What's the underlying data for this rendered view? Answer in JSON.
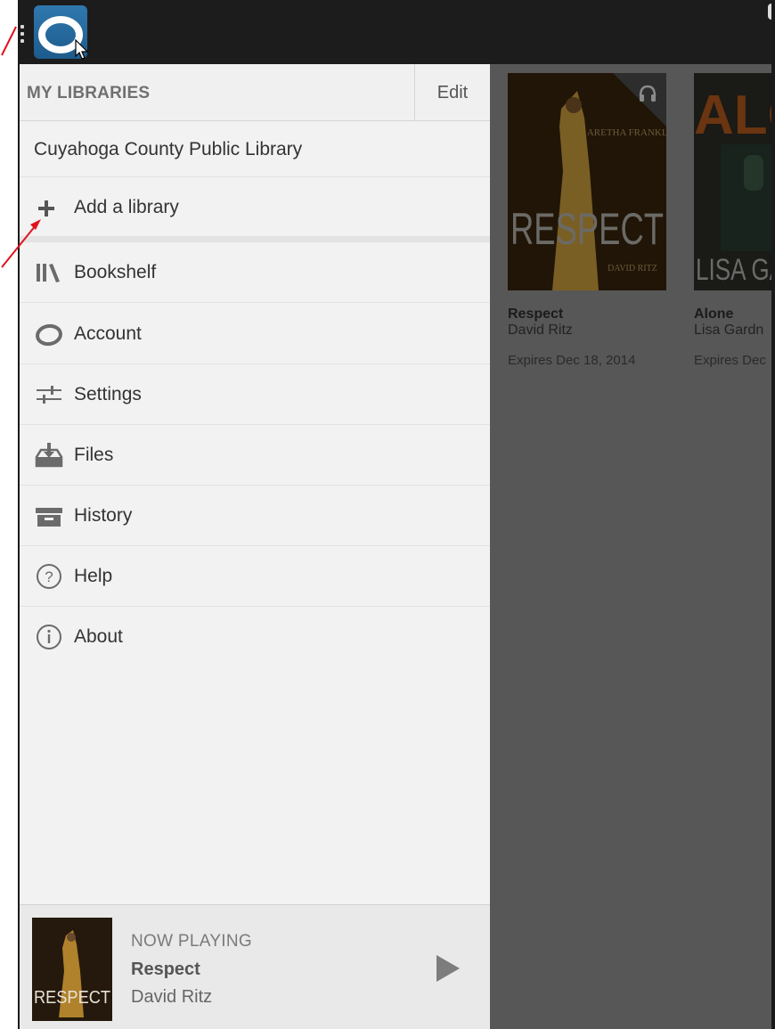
{
  "drawer": {
    "title": "MY LIBRARIES",
    "edit_label": "Edit",
    "library_name": "Cuyahoga County Public Library",
    "add_library_label": "Add a library",
    "items": [
      {
        "label": "Bookshelf",
        "icon": "bookshelf-icon"
      },
      {
        "label": "Account",
        "icon": "account-icon"
      },
      {
        "label": "Settings",
        "icon": "settings-icon"
      },
      {
        "label": "Files",
        "icon": "files-icon"
      },
      {
        "label": "History",
        "icon": "history-icon"
      },
      {
        "label": "Help",
        "icon": "help-icon"
      },
      {
        "label": "About",
        "icon": "about-icon"
      }
    ]
  },
  "now_playing": {
    "label": "NOW PLAYING",
    "title": "Respect",
    "author": "David Ritz",
    "cover_text": "RESPECT"
  },
  "books": [
    {
      "title": "Respect",
      "author": "David Ritz",
      "expires": "Expires Dec 18, 2014",
      "cover_text": "RESPECT",
      "cover_sub": "ARETHA FRANKLIN",
      "cover_author": "DAVID RITZ",
      "format_icon": "headphones-icon"
    },
    {
      "title": "Alone",
      "author": "Lisa Gardn",
      "expires": "Expires Dec",
      "cover_text": "ALO",
      "cover_author": "LISA GA"
    }
  ],
  "colors": {
    "actionbar": "#1c1c1c",
    "logo": "#2a6fa5",
    "drawer_bg": "#f2f2f2",
    "content_dim": "#575757",
    "annotation_arrow": "#e0141e"
  }
}
